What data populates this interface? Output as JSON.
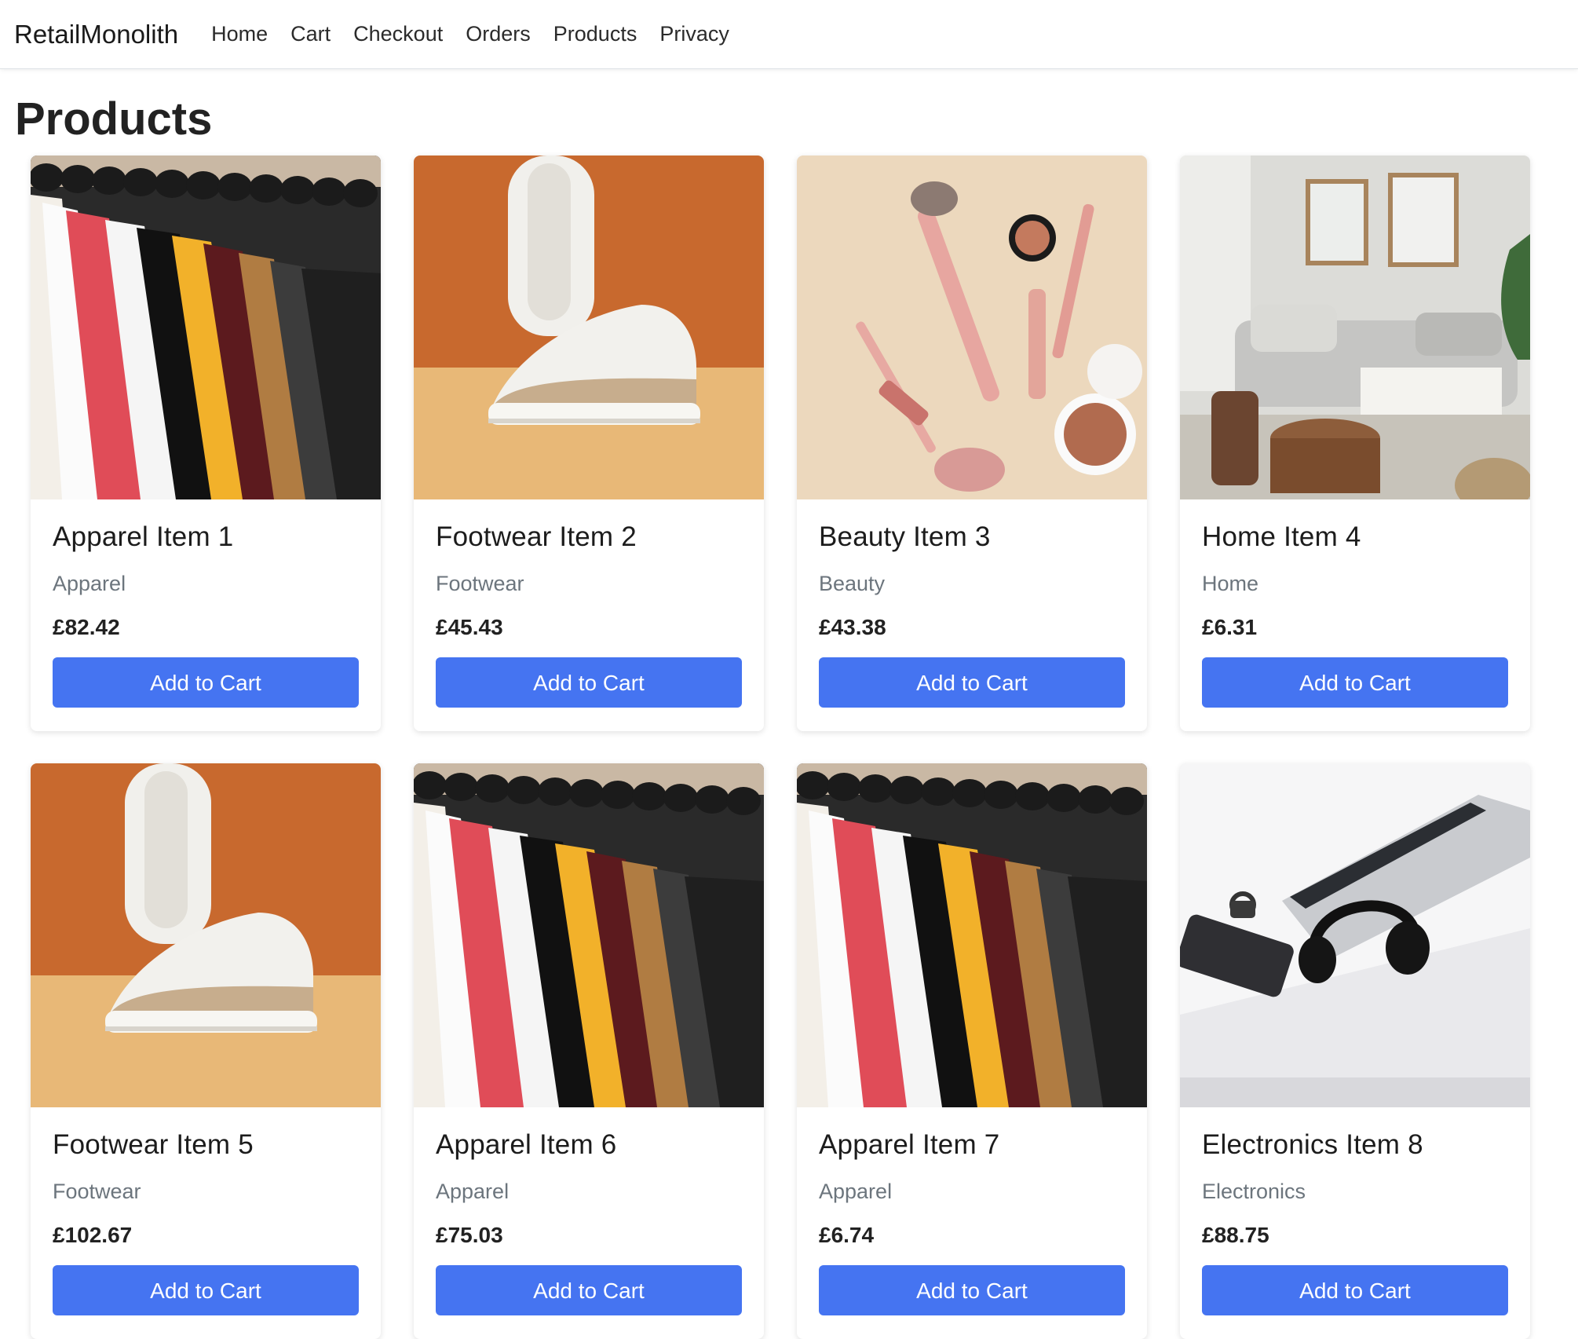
{
  "navbar": {
    "brand": "RetailMonolith",
    "links": [
      "Home",
      "Cart",
      "Checkout",
      "Orders",
      "Products",
      "Privacy"
    ]
  },
  "page": {
    "title": "Products"
  },
  "products": [
    {
      "name": "Apparel Item 1",
      "category": "Apparel",
      "price": "£82.42",
      "button": "Add to Cart",
      "image": "apparel"
    },
    {
      "name": "Footwear Item 2",
      "category": "Footwear",
      "price": "£45.43",
      "button": "Add to Cart",
      "image": "footwear"
    },
    {
      "name": "Beauty Item 3",
      "category": "Beauty",
      "price": "£43.38",
      "button": "Add to Cart",
      "image": "beauty"
    },
    {
      "name": "Home Item 4",
      "category": "Home",
      "price": "£6.31",
      "button": "Add to Cart",
      "image": "home"
    },
    {
      "name": "Footwear Item 5",
      "category": "Footwear",
      "price": "£102.67",
      "button": "Add to Cart",
      "image": "footwear"
    },
    {
      "name": "Apparel Item 6",
      "category": "Apparel",
      "price": "£75.03",
      "button": "Add to Cart",
      "image": "apparel"
    },
    {
      "name": "Apparel Item 7",
      "category": "Apparel",
      "price": "£6.74",
      "button": "Add to Cart",
      "image": "apparel"
    },
    {
      "name": "Electronics Item 8",
      "category": "Electronics",
      "price": "£88.75",
      "button": "Add to Cart",
      "image": "electronics"
    }
  ],
  "colors": {
    "button": "#4574f1",
    "muted": "#6c757d"
  }
}
